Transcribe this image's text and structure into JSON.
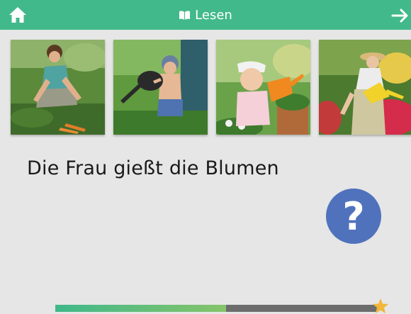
{
  "header": {
    "title": "Lesen",
    "home_icon": "home-icon",
    "book_icon": "book-icon",
    "next_icon": "arrow-right-icon",
    "color": "#42b98a"
  },
  "images": [
    {
      "name": "woman-harvesting-carrots"
    },
    {
      "name": "child-with-watering-can"
    },
    {
      "name": "girl-with-orange-watering-can"
    },
    {
      "name": "woman-watering-flowers"
    }
  ],
  "sentence": "Die Frau gießt die Blumen",
  "help_button": {
    "label": "?",
    "color": "#5072bd"
  },
  "progress": {
    "fraction": 0.53,
    "fill_color": "#3fb88a",
    "track_color": "#6d6d6d",
    "end_icon": "star-icon"
  }
}
